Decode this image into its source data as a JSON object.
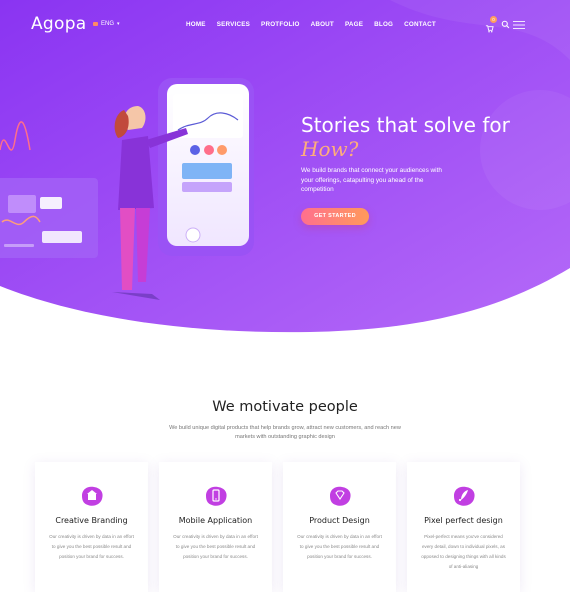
{
  "brand": {
    "logo": "Agopa",
    "lang": "ENG"
  },
  "nav": {
    "items": [
      "HOME",
      "SERVICES",
      "PROTFOLIO",
      "ABOUT",
      "PAGE",
      "BLOG",
      "CONTACT"
    ]
  },
  "header": {
    "cart_count": "0"
  },
  "hero": {
    "title": "Stories that solve for",
    "title_highlight": "How?",
    "subtitle": "We build brands that connect your audiences with your offerings, catapulting you ahead of the competition",
    "cta": "GET STARTED"
  },
  "features": {
    "title": "We motivate people",
    "subtitle": "We build unique digital products that help brands grow, attract new customers, and reach new markets with outstanding graphic design",
    "cards": [
      {
        "icon": "store-icon",
        "title": "Creative Branding",
        "text": "Our creativity is driven by data in an effort to give you the best possible result and position your brand for success."
      },
      {
        "icon": "mobile-icon",
        "title": "Mobile Application",
        "text": "Our creativity is driven by data in an effort to give you the best possible result and position your brand for success."
      },
      {
        "icon": "diamond-icon",
        "title": "Product Design",
        "text": "Our creativity is driven by data in an effort to give you the best possible result and position your brand for success."
      },
      {
        "icon": "rocket-icon",
        "title": "Pixel perfect design",
        "text": "Pixel-perfect means you've considered every detail, down to individual pixels, as opposed to designing things with all kinds of anti-aliasing"
      }
    ]
  },
  "colors": {
    "hero_start": "#8d3df5",
    "hero_end": "#b66bf8",
    "accent": "#ff7a7a",
    "highlight": "#ffae7a"
  }
}
